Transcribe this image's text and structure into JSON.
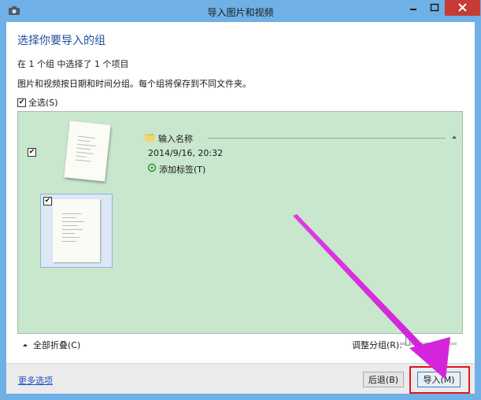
{
  "window": {
    "title": "导入图片和视频",
    "minimize_glyph": "–",
    "maximize_glyph": "▭",
    "close_glyph": "✕"
  },
  "main": {
    "heading": "选择你要导入的组",
    "selection_summary": "在 1 个组 中选择了 1 个项目",
    "description": "图片和视频按日期和时间分组。每个组将保存到不同文件夹。",
    "select_all": {
      "label": "全选(S)",
      "checked": true
    }
  },
  "group": {
    "checked": true,
    "name_placeholder": "输入名称",
    "date": "2014/9/16, 20:32",
    "add_tag": "添加标签(T)",
    "items": [
      {
        "checked": true
      }
    ]
  },
  "controls": {
    "collapse_all": "全部折叠(C)",
    "adjust_groups": "调整分组(R):",
    "adjust_level": 0.1
  },
  "footer": {
    "more_options": "更多选项",
    "back_button": "后退(B)",
    "import_button": "导入(M)"
  },
  "icons": {
    "app": "camera-icon",
    "folder": "folder-icon",
    "tag": "tag-icon",
    "collapse": "chevron-up-icon"
  },
  "colors": {
    "titlebar": "#6fb0e6",
    "close_button": "#c73b35",
    "panel": "#c8e7cc",
    "heading": "#1e4fa0",
    "link": "#1d54c6",
    "annotation_arrow": "#e23ae6",
    "highlight_box": "#e3141c"
  }
}
